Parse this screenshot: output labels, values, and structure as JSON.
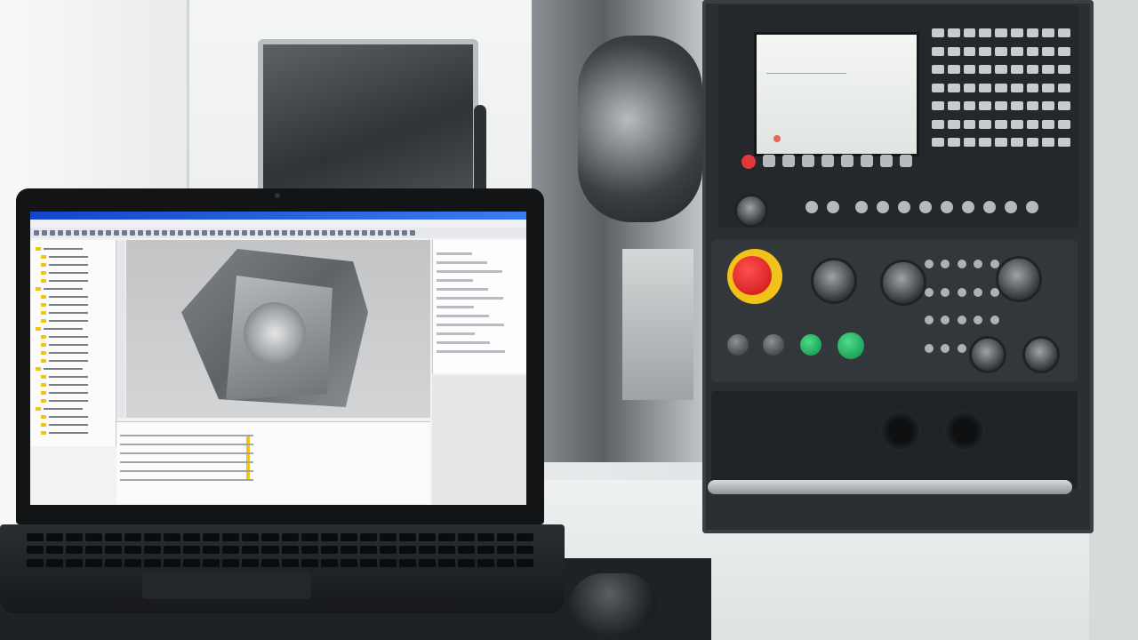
{
  "scene": {
    "subject": "",
    "colors": {
      "estop_red": "#e02222",
      "estop_ring": "#f0c21a",
      "panel_dark": "#2b2f33",
      "button_green": "#11a35a",
      "software_titlebar": "#1446c8",
      "tree_folder": "#f1c40f"
    },
    "laptop": {
      "screen_app": {
        "title": "",
        "menu_items": [],
        "tree_items": [
          "",
          "",
          "",
          "",
          "",
          "",
          "",
          "",
          "",
          "",
          "",
          "",
          "",
          "",
          "",
          "",
          "",
          "",
          "",
          "",
          "",
          "",
          "",
          ""
        ],
        "properties_rows": 12,
        "bottom_rows": 6
      }
    },
    "cnc_panel": {
      "screen_text": "",
      "keypad_keys": 63,
      "softkeys": 8
    }
  }
}
